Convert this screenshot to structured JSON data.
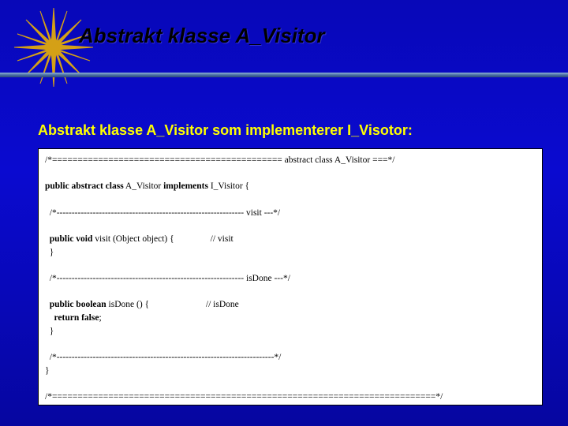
{
  "slide": {
    "title": "Abstrakt klasse   A_Visitor",
    "subtitle": "Abstrakt klasse  A_Visitor som implementerer I_Visotor:"
  },
  "code": {
    "l1a": "/*============================================= abstract class A_Visitor ===*/",
    "l2_kw": "public abstract class",
    "l2_mid": " A_Visitor ",
    "l2_kw2": "implements",
    "l2_end": " I_Visitor {",
    "l3a": "  /*-------------------------------------------------------------- visit ---*/",
    "l4_pre": "  ",
    "l4_kw": "public void",
    "l4_rest": " visit (Object object) {                // visit",
    "l5": "  }",
    "l6a": "  /*-------------------------------------------------------------- isDone ---*/",
    "l7_pre": "  ",
    "l7_kw": "public boolean",
    "l7_rest": " isDone () {                         // isDone",
    "l8_pre": "    ",
    "l8_kw": "return false",
    "l8_end": ";",
    "l9": "  }",
    "l10a": "  /*------------------------------------------------------------------------*/",
    "l11": "}",
    "l12a": "/*===========================================================================*/"
  }
}
